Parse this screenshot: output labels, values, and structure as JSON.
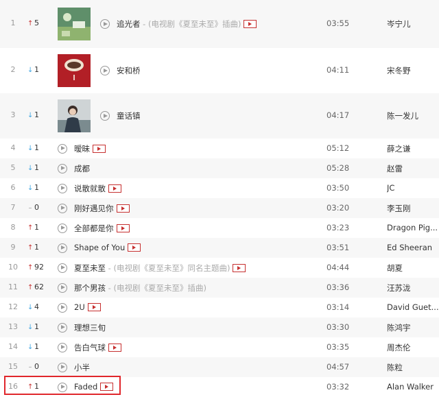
{
  "songs": [
    {
      "rank": "1",
      "trend": "up",
      "change": "5",
      "title": "追光者",
      "subtitle": " - (电视剧《夏至未至》插曲)",
      "mv": true,
      "duration": "03:55",
      "artist": "岑宁儿"
    },
    {
      "rank": "2",
      "trend": "down",
      "change": "1",
      "title": "安和桥",
      "subtitle": "",
      "mv": false,
      "duration": "04:11",
      "artist": "宋冬野"
    },
    {
      "rank": "3",
      "trend": "down",
      "change": "1",
      "title": "童话镇",
      "subtitle": "",
      "mv": false,
      "duration": "04:17",
      "artist": "陈一发儿"
    },
    {
      "rank": "4",
      "trend": "down",
      "change": "1",
      "title": "暧昧",
      "subtitle": "",
      "mv": true,
      "duration": "05:12",
      "artist": "薛之谦"
    },
    {
      "rank": "5",
      "trend": "down",
      "change": "1",
      "title": "成都",
      "subtitle": "",
      "mv": false,
      "duration": "05:28",
      "artist": "赵雷"
    },
    {
      "rank": "6",
      "trend": "down",
      "change": "1",
      "title": "说散就散",
      "subtitle": "",
      "mv": true,
      "duration": "03:50",
      "artist": "JC"
    },
    {
      "rank": "7",
      "trend": "same",
      "change": "0",
      "title": "刚好遇见你",
      "subtitle": "",
      "mv": true,
      "duration": "03:20",
      "artist": "李玉刚"
    },
    {
      "rank": "8",
      "trend": "up",
      "change": "1",
      "title": "全部都是你",
      "subtitle": "",
      "mv": true,
      "duration": "03:23",
      "artist": "Dragon Pig..."
    },
    {
      "rank": "9",
      "trend": "up",
      "change": "1",
      "title": "Shape of You",
      "subtitle": "",
      "mv": true,
      "duration": "03:51",
      "artist": "Ed Sheeran"
    },
    {
      "rank": "10",
      "trend": "up",
      "change": "92",
      "title": "夏至未至",
      "subtitle": " - (电视剧《夏至未至》同名主题曲)",
      "mv": true,
      "duration": "04:44",
      "artist": "胡夏"
    },
    {
      "rank": "11",
      "trend": "up",
      "change": "62",
      "title": "那个男孩",
      "subtitle": " - (电视剧《夏至未至》插曲)",
      "mv": false,
      "duration": "03:36",
      "artist": "汪苏泷"
    },
    {
      "rank": "12",
      "trend": "down",
      "change": "4",
      "title": "2U",
      "subtitle": "",
      "mv": true,
      "duration": "03:14",
      "artist": "David Guet..."
    },
    {
      "rank": "13",
      "trend": "down",
      "change": "1",
      "title": "理想三旬",
      "subtitle": "",
      "mv": false,
      "duration": "03:30",
      "artist": "陈鸿宇"
    },
    {
      "rank": "14",
      "trend": "down",
      "change": "1",
      "title": "告白气球",
      "subtitle": "",
      "mv": true,
      "duration": "03:35",
      "artist": "周杰伦"
    },
    {
      "rank": "15",
      "trend": "same",
      "change": "0",
      "title": "小半",
      "subtitle": "",
      "mv": false,
      "duration": "04:57",
      "artist": "陈粒"
    },
    {
      "rank": "16",
      "trend": "up",
      "change": "1",
      "title": "Faded",
      "subtitle": "",
      "mv": true,
      "duration": "03:32",
      "artist": "Alan Walker"
    }
  ],
  "colors": {
    "accent": "#c62f2f",
    "trend_up": "#c62f2f",
    "trend_down": "#3fa4e0",
    "highlight": "#e0262b"
  }
}
